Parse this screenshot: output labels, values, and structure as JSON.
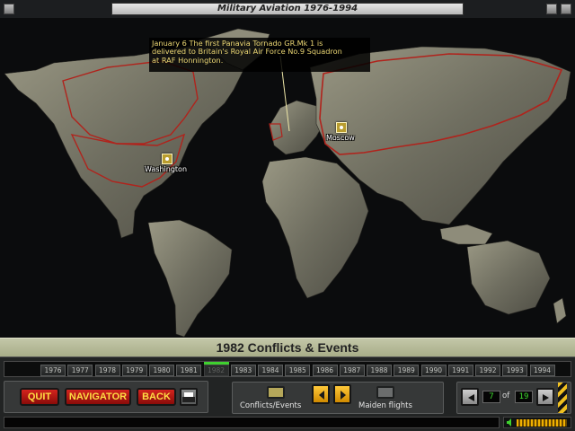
{
  "window": {
    "title": "Military Aviation 1976-1994"
  },
  "event": {
    "text": "January 6 The first Panavia Tornado GR.Mk 1 is\ndelivered to Britain's Royal Air Force No.9 Squadron\nat RAF Honnington."
  },
  "map": {
    "cities": [
      {
        "name": "Washington"
      },
      {
        "name": "Moscow"
      }
    ],
    "colors": {
      "border": "#b0231c",
      "land": "#7b7a69",
      "ocean": "#0b0c0d",
      "marker": "#b99d2f"
    }
  },
  "heading": "1982 Conflicts & Events",
  "years": {
    "items": [
      "1976",
      "1977",
      "1978",
      "1979",
      "1980",
      "1981",
      "1982",
      "1983",
      "1984",
      "1985",
      "1986",
      "1987",
      "1988",
      "1989",
      "1990",
      "1991",
      "1992",
      "1993",
      "1994"
    ],
    "selected": "1982"
  },
  "controls": {
    "quit_label": "QUIT",
    "navigator_label": "NAVIGATOR",
    "back_label": "BACK",
    "print_icon": "printer-icon",
    "mode_conflicts_label": "Conflicts/Events",
    "mode_maiden_label": "Maiden flights",
    "prev_icon": "arrow-left-icon",
    "next_icon": "arrow-right-icon"
  },
  "pager": {
    "current": "7",
    "of_label": "of",
    "total": "19"
  },
  "audio": {
    "icon": "speaker-icon"
  },
  "accent_colors": {
    "quit_red": "#c01c17",
    "button_text": "#ffde44",
    "active_year": "#3fd02f",
    "page_digits": "#3fdc2f"
  }
}
